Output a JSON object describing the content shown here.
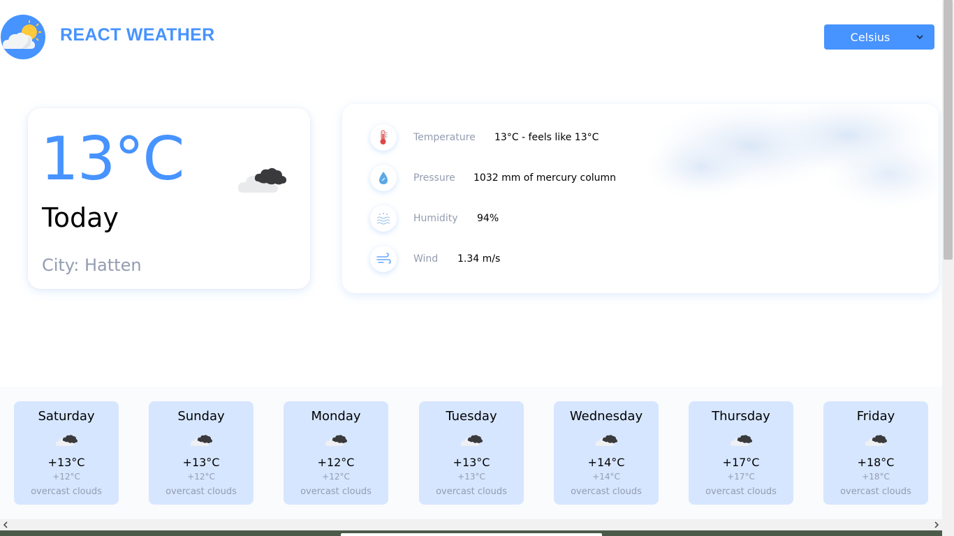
{
  "header": {
    "title": "REACT WEATHER",
    "logo_icon": "cloud-sun-logo-icon",
    "unit_select": {
      "value": "Celsius",
      "icon": "chevron-down-icon"
    }
  },
  "today": {
    "temperature": "13°C",
    "day": "Today",
    "city": "City: Hatten",
    "icon": "overcast-clouds-icon"
  },
  "details": [
    {
      "icon": "thermometer-icon",
      "label": "Temperature",
      "value": "13°C - feels like 13°C"
    },
    {
      "icon": "pressure-drop-icon",
      "label": "Pressure",
      "value": "1032 mm of mercury column"
    },
    {
      "icon": "humidity-icon",
      "label": "Humidity",
      "value": "94%"
    },
    {
      "icon": "wind-icon",
      "label": "Wind",
      "value": "1.34 m/s"
    }
  ],
  "forecast": [
    {
      "day": "Saturday",
      "max": "+13°C",
      "min": "+12°C",
      "desc": "overcast clouds"
    },
    {
      "day": "Sunday",
      "max": "+13°C",
      "min": "+12°C",
      "desc": "overcast clouds"
    },
    {
      "day": "Monday",
      "max": "+12°C",
      "min": "+12°C",
      "desc": "overcast clouds"
    },
    {
      "day": "Tuesday",
      "max": "+13°C",
      "min": "+13°C",
      "desc": "overcast clouds"
    },
    {
      "day": "Wednesday",
      "max": "+14°C",
      "min": "+14°C",
      "desc": "overcast clouds"
    },
    {
      "day": "Thursday",
      "max": "+17°C",
      "min": "+17°C",
      "desc": "overcast clouds"
    },
    {
      "day": "Friday",
      "max": "+18°C",
      "min": "+18°C",
      "desc": "overcast clouds"
    }
  ],
  "colors": {
    "accent": "#4793ff",
    "muted": "#939cb0",
    "forecast_card": "#d6e6ff"
  }
}
